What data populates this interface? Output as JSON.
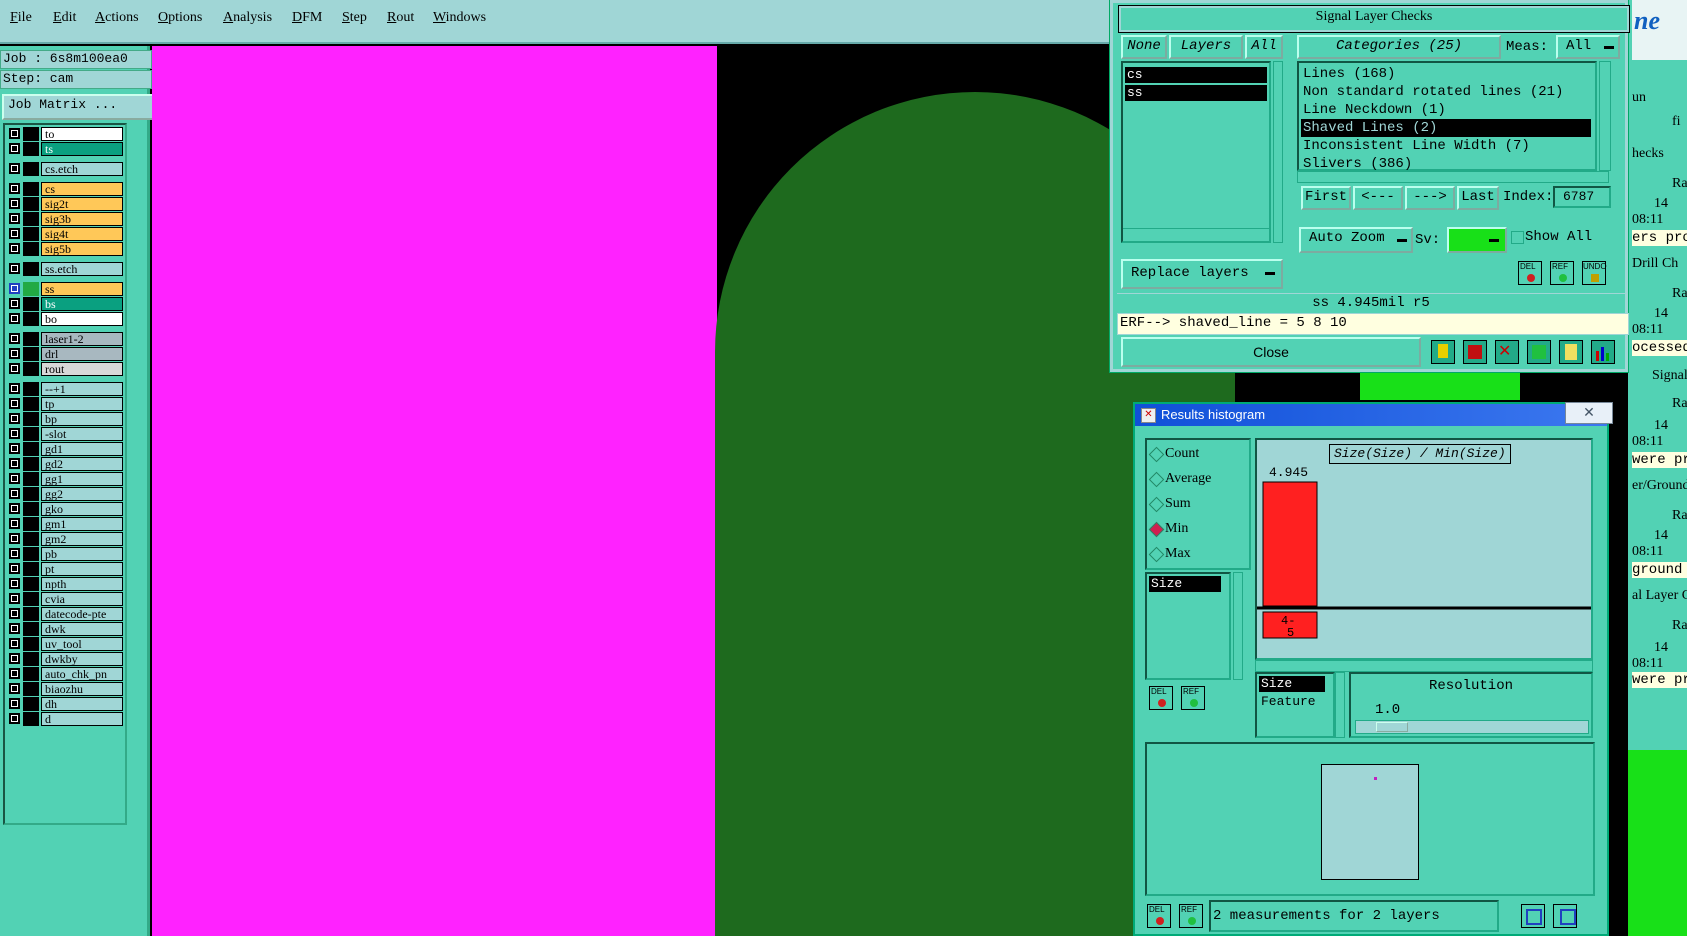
{
  "menu": [
    "File",
    "Edit",
    "Actions",
    "Options",
    "Analysis",
    "DFM",
    "Step",
    "Rout",
    "Windows"
  ],
  "job": {
    "job_line": "Job : 6s8m100ea0",
    "step_line": "Step: cam",
    "matrix_button": "Job Matrix ..."
  },
  "layers": [
    {
      "name": "to",
      "color": "#ffffff"
    },
    {
      "name": "ts",
      "color": "#0aa080"
    },
    {
      "name": "cs.etch",
      "color": "#a0d6d6"
    },
    {
      "name": "cs",
      "color": "#ffc858"
    },
    {
      "name": "sig2t",
      "color": "#ffc858"
    },
    {
      "name": "sig3b",
      "color": "#ffc858"
    },
    {
      "name": "sig4t",
      "color": "#ffc858"
    },
    {
      "name": "sig5b",
      "color": "#ffc858"
    },
    {
      "name": "ss.etch",
      "color": "#a0d6d6"
    },
    {
      "name": "ss",
      "color": "#ffc858"
    },
    {
      "name": "bs",
      "color": "#0aa080"
    },
    {
      "name": "bo",
      "color": "#ffffff"
    },
    {
      "name": "laser1-2",
      "color": "#a8b8c0"
    },
    {
      "name": "drl",
      "color": "#a8b8c0"
    },
    {
      "name": "rout",
      "color": "#d8d8d8"
    },
    {
      "name": "--+1",
      "color": "#a0d6d6"
    },
    {
      "name": "tp",
      "color": "#a0d6d6"
    },
    {
      "name": "bp",
      "color": "#a0d6d6"
    },
    {
      "name": "-slot",
      "color": "#a0d6d6"
    },
    {
      "name": "gd1",
      "color": "#a0d6d6"
    },
    {
      "name": "gd2",
      "color": "#a0d6d6"
    },
    {
      "name": "gg1",
      "color": "#a0d6d6"
    },
    {
      "name": "gg2",
      "color": "#a0d6d6"
    },
    {
      "name": "gko",
      "color": "#a0d6d6"
    },
    {
      "name": "gm1",
      "color": "#a0d6d6"
    },
    {
      "name": "gm2",
      "color": "#a0d6d6"
    },
    {
      "name": "pb",
      "color": "#a0d6d6"
    },
    {
      "name": "pt",
      "color": "#a0d6d6"
    },
    {
      "name": "npth",
      "color": "#a0d6d6"
    },
    {
      "name": "cvia",
      "color": "#a0d6d6"
    },
    {
      "name": "datecode-pte",
      "color": "#a0d6d6"
    },
    {
      "name": "dwk",
      "color": "#a0d6d6"
    },
    {
      "name": "uv_tool",
      "color": "#a0d6d6"
    },
    {
      "name": "dwkby",
      "color": "#a0d6d6"
    },
    {
      "name": "auto_chk_pn",
      "color": "#a0d6d6"
    },
    {
      "name": "biaozhu",
      "color": "#a0d6d6"
    },
    {
      "name": "dh",
      "color": "#a0d6d6"
    },
    {
      "name": "d",
      "color": "#a0d6d6"
    }
  ],
  "slc": {
    "title": "Signal Layer Checks",
    "none_btn": "None",
    "layers_btn": "Layers",
    "all_btn": "All",
    "categories_btn": "Categories (25)",
    "meas_label": "Meas:",
    "meas_value": "All",
    "layer_list": [
      "cs",
      "ss"
    ],
    "categories": [
      "Lines (168)",
      "Non standard rotated lines (21)",
      "Line Neckdown (1)",
      "Shaved Lines (2)",
      "Inconsistent Line Width (7)",
      "Slivers (386)"
    ],
    "selected_category": 3,
    "nav": {
      "first": "First",
      "prev": "<---",
      "next": "--->",
      "last": "Last",
      "index_label": "Index:",
      "index_value": "6787"
    },
    "auto_zoom": "Auto Zoom",
    "sv_label": "Sv:",
    "show_all": "Show All",
    "replace_layers": "Replace layers",
    "del": "DEL",
    "ref": "REF",
    "undo": "UNDO",
    "status": "ss 4.945mil  r5",
    "erf": "ERF--> shaved_line = 5 8 10",
    "close": "Close"
  },
  "hist": {
    "title": "Results histogram",
    "modes": [
      "Count",
      "Average",
      "Sum",
      "Min",
      "Max"
    ],
    "selected_mode": "Min",
    "list_item": "Size",
    "chart_title": "Size(Size) / Min(Size)",
    "sort_items": [
      "Size",
      "Feature"
    ],
    "resolution_label": "Resolution",
    "resolution_value": "1.0",
    "footer": "2 measurements for 2 layers",
    "del": "DEL",
    "ref": "REF"
  },
  "chart_data": {
    "type": "bar",
    "title": "Size(Size) / Min(Size)",
    "categories": [
      "4-5"
    ],
    "values": [
      4.945
    ],
    "bar_labels": [
      "4.945"
    ],
    "xlabel": "",
    "ylabel": ""
  },
  "right_fragments": [
    "ne",
    "un",
    "fi",
    "hecks",
    "Ra",
    "14",
    "08:11",
    "ers pro",
    "Drill Ch",
    "Ra",
    "14",
    "08:11",
    "ocessed",
    "Signal Layer Ch",
    "Ra",
    "14",
    "08:11",
    "were pro",
    "er/Ground C",
    "Ra",
    "14",
    "08:11",
    "ground la",
    "al Layer Ch",
    "Ra",
    "14",
    "08:11",
    "were pro"
  ],
  "colors": {
    "panel": "#52d2b4",
    "light": "#a0d6d6",
    "magenta": "#ff22ff",
    "board": "#1e6a1e",
    "bar": "#ff2020"
  }
}
